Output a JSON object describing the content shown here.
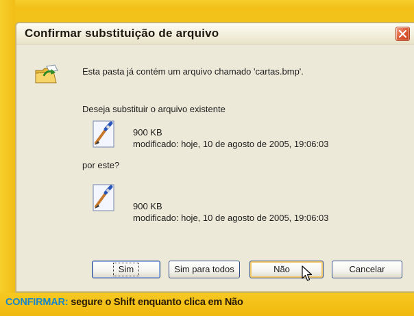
{
  "dialog": {
    "title": "Confirmar substituição de arquivo",
    "message": "Esta pasta já contém um arquivo chamado 'cartas.bmp'.",
    "question": "Deseja substituir o arquivo existente",
    "existing_file": {
      "size": "900 KB",
      "modified": "modificado: hoje, 10 de agosto de 2005, 19:06:03",
      "icon": "paint-brush-file-icon"
    },
    "by_this": "por este?",
    "new_file": {
      "size": "900 KB",
      "modified": "modificado: hoje, 10 de agosto de 2005, 19:06:03",
      "icon": "paint-brush-file-icon"
    },
    "buttons": {
      "yes": "Sim",
      "yes_to_all": "Sim para todos",
      "no": "Não",
      "cancel": "Cancelar"
    }
  },
  "caption": {
    "label": "CONFIRMAR:",
    "text": " segure o Shift enquanto clica em Não"
  },
  "colors": {
    "frame": "#f3c21a",
    "caption_label": "#1a86c7",
    "close_button": "#de5a34",
    "dialog_bg": "#ece9d8"
  }
}
